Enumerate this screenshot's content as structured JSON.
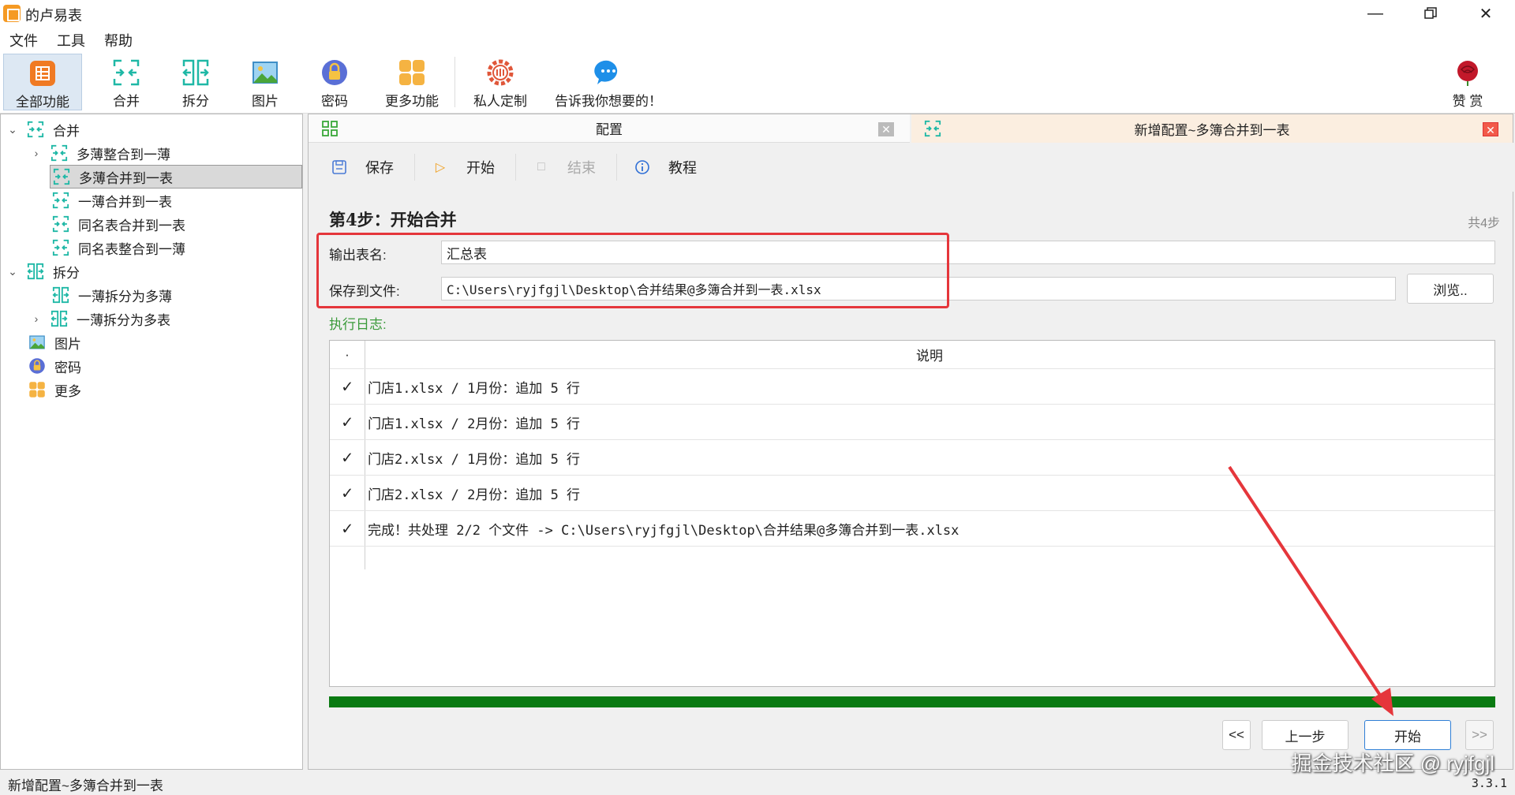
{
  "app": {
    "title": "的卢易表",
    "version": "3.3.1"
  },
  "menu": [
    "文件",
    "工具",
    "帮助"
  ],
  "toolbar": {
    "items": [
      {
        "label": "全部功能",
        "icon": "grid-app-icon"
      },
      {
        "label": "合并",
        "icon": "merge-icon"
      },
      {
        "label": "拆分",
        "icon": "split-icon"
      },
      {
        "label": "图片",
        "icon": "image-icon"
      },
      {
        "label": "密码",
        "icon": "lock-icon"
      },
      {
        "label": "更多功能",
        "icon": "more-icon"
      },
      {
        "label": "私人定制",
        "icon": "custom-gear-icon"
      },
      {
        "label": "告诉我你想要的！",
        "icon": "chat-bubble-icon"
      }
    ],
    "reward": {
      "label": "赞 赏",
      "icon": "rose-icon"
    }
  },
  "tree": {
    "merge": {
      "label": "合并",
      "children": [
        "多薄整合到一薄",
        "多薄合并到一表",
        "一薄合并到一表",
        "同名表合并到一表",
        "同名表整合到一薄"
      ]
    },
    "split": {
      "label": "拆分",
      "children": [
        "一薄拆分为多薄",
        "一薄拆分为多表"
      ]
    },
    "image": "图片",
    "password": "密码",
    "more": "更多"
  },
  "tabs": [
    {
      "title": "配置"
    },
    {
      "title": "新增配置~多簿合并到一表"
    }
  ],
  "actions": {
    "save": "保存",
    "start": "开始",
    "stop": "结束",
    "tutorial": "教程"
  },
  "step": {
    "title": "第4步：开始合并",
    "total": "共4步"
  },
  "form": {
    "output_label": "输出表名:",
    "output_value": "汇总表",
    "save_label": "保存到文件:",
    "save_value": "C:\\Users\\ryjfgjl\\Desktop\\合并结果@多簿合并到一表.xlsx",
    "browse": "浏览.."
  },
  "log": {
    "label": "执行日志:",
    "header_mark": "·",
    "header_desc": "说明",
    "rows": [
      {
        "mark": "✓",
        "text": "门店1.xlsx / 1月份：追加 5 行"
      },
      {
        "mark": "✓",
        "text": "门店1.xlsx / 2月份：追加 5 行"
      },
      {
        "mark": "✓",
        "text": "门店2.xlsx / 1月份：追加 5 行"
      },
      {
        "mark": "✓",
        "text": "门店2.xlsx / 2月份：追加 5 行"
      },
      {
        "mark": "✓",
        "text": "完成！共处理 2/2 个文件 -> C:\\Users\\ryjfgjl\\Desktop\\合并结果@多簿合并到一表.xlsx"
      }
    ]
  },
  "progress": 1.0,
  "nav": {
    "first": "<<",
    "prev": "上一步",
    "start": "开始",
    "last": ">>"
  },
  "status": {
    "text": "新增配置~多簿合并到一表"
  },
  "watermark": "掘金技术社区 @ ryjfgjl",
  "colors": {
    "accent": "#e5363b",
    "progress": "#0a7a12",
    "log_label": "#3a9a3a",
    "merge_icon": "#1fb8a6"
  }
}
